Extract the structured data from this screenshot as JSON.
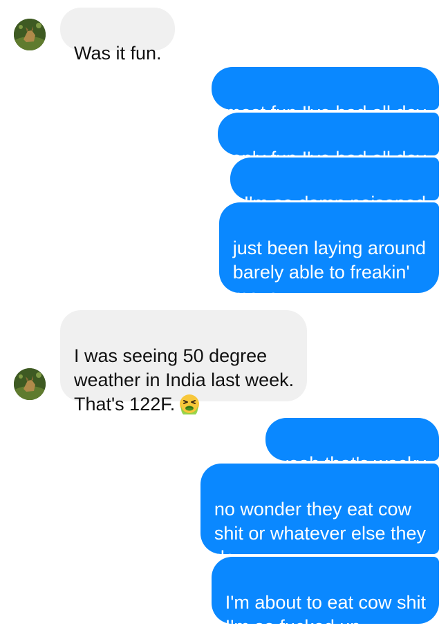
{
  "contact": {
    "avatar_icon": "contact-avatar-icon"
  },
  "messages": [
    {
      "from": "them",
      "text": "Was it fun."
    },
    {
      "from": "me",
      "text": "most fun I've had all day"
    },
    {
      "from": "me",
      "text": "only fun I've had all day"
    },
    {
      "from": "me",
      "text": "I'm so damn poisoned"
    },
    {
      "from": "me",
      "text": "just been laying around\nbarely able to freakin'\nmove"
    },
    {
      "from": "them",
      "text": "I was seeing 50 degree\nweather in India last week.\nThat's 122F.",
      "emoji": "nauseated-face-icon"
    },
    {
      "from": "me",
      "text": "yeah that's wacky"
    },
    {
      "from": "me",
      "text": "no wonder they eat cow\nshit or whatever else they\ndo"
    },
    {
      "from": "me",
      "text": "I'm about to eat cow shit\nI'm so fucked up"
    }
  ],
  "colors": {
    "outgoing_bubble": "#0a88ff",
    "incoming_bubble": "#f0f0f0",
    "outgoing_text": "#ffffff",
    "incoming_text": "#111111"
  }
}
